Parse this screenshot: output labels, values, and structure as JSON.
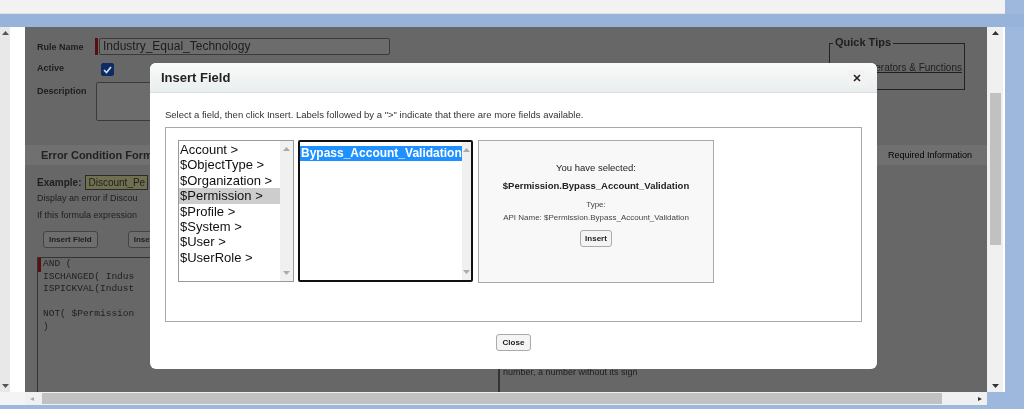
{
  "page": {
    "rule_name_label": "Rule Name",
    "rule_name_value": "Industry_Equal_Technology",
    "active_label": "Active",
    "active_checked": true,
    "description_label": "Description",
    "quick_tips": {
      "legend": "Quick Tips",
      "link": "erators & Functions"
    },
    "section_title": "Error Condition Form",
    "required_legend": "Required Information",
    "example_label": "Example:",
    "example_value": "Discount_Pe",
    "display_text": "Display an error if Discou",
    "if_text": "If this formula expression",
    "buttons": [
      "Insert Field",
      "Inse"
    ],
    "formula": "AND (\nISCHANGED( Indus\nISPICKVAL(Indust\n\nNOT( $Permission\n)",
    "help_text": "number, a number without its sign"
  },
  "dialog": {
    "title": "Insert Field",
    "instructions": "Select a field, then click Insert. Labels followed by a \">\" indicate that there are more fields available.",
    "categories": [
      {
        "label": "Account >",
        "selected": false
      },
      {
        "label": "$ObjectType >",
        "selected": false
      },
      {
        "label": "$Organization >",
        "selected": false
      },
      {
        "label": "$Permission >",
        "selected": true
      },
      {
        "label": "$Profile >",
        "selected": false
      },
      {
        "label": "$System >",
        "selected": false
      },
      {
        "label": "$User >",
        "selected": false
      },
      {
        "label": "$UserRole >",
        "selected": false
      }
    ],
    "fields": [
      {
        "label": "Bypass_Account_Validation",
        "selected": true
      }
    ],
    "selection": {
      "heading": "You have selected:",
      "value": "$Permission.Bypass_Account_Validation",
      "type_label": "Type:",
      "api_name": "API Name: $Permission.Bypass_Account_Validation",
      "insert_button": "Insert"
    },
    "close_button": "Close"
  }
}
